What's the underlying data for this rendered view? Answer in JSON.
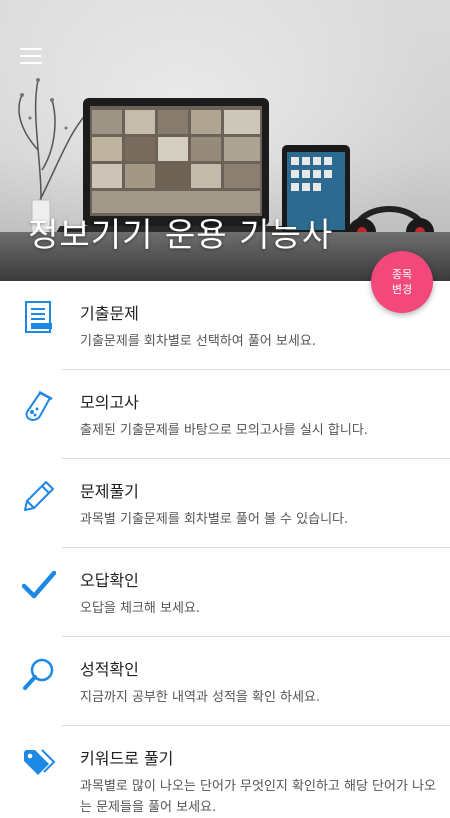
{
  "header": {
    "title": "정보기기 운용 기능사",
    "change_button": [
      "종목",
      "변경"
    ]
  },
  "colors": {
    "accent": "#1e88e5",
    "fab": "#f2487a"
  },
  "menu": [
    {
      "icon": "document-list-icon",
      "title": "기출문제",
      "desc": "기출문제를 회차별로 선택하여 풀어 보세요."
    },
    {
      "icon": "flask-icon",
      "title": "모의고사",
      "desc": "출제된 기출문제를 바탕으로 모의고사를 실시 합니다."
    },
    {
      "icon": "pencil-icon",
      "title": "문제풀기",
      "desc": "과목별 기출문제를 회차별로 풀어 볼 수 있습니다."
    },
    {
      "icon": "checkmark-icon",
      "title": "오답확인",
      "desc": "오답을 체크해 보세요."
    },
    {
      "icon": "magnifier-icon",
      "title": "성적확인",
      "desc": "지금까지 공부한 내역과 성적을 확인 하세요."
    },
    {
      "icon": "tag-icon",
      "title": "키워드로 풀기",
      "desc": "과목별로 많이 나오는 단어가 무엇인지 확인하고 해당 단어가 나오는 문제들을 풀어 보세요."
    }
  ]
}
